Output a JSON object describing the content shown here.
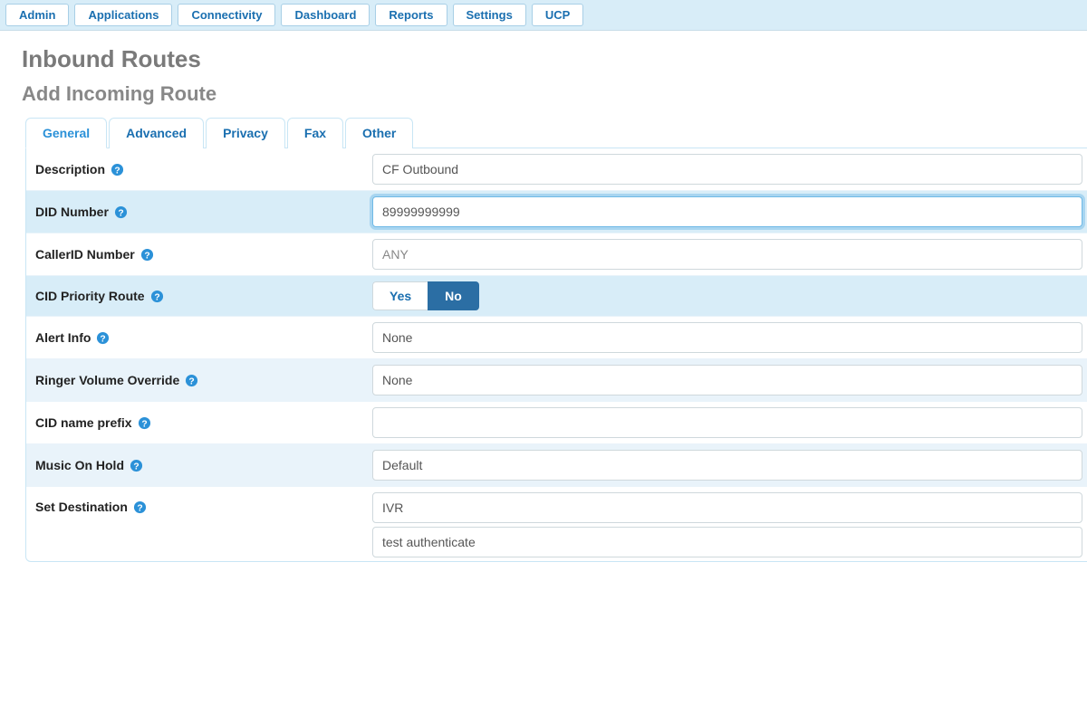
{
  "topnav": {
    "items": [
      "Admin",
      "Applications",
      "Connectivity",
      "Dashboard",
      "Reports",
      "Settings",
      "UCP"
    ]
  },
  "page_title": "Inbound Routes",
  "page_subtitle": "Add Incoming Route",
  "tabs": {
    "items": [
      "General",
      "Advanced",
      "Privacy",
      "Fax",
      "Other"
    ],
    "active": "General"
  },
  "form": {
    "description": {
      "label": "Description",
      "value": "CF Outbound"
    },
    "did_number": {
      "label": "DID Number",
      "value": "89999999999"
    },
    "callerid_number": {
      "label": "CallerID Number",
      "placeholder": "ANY",
      "value": ""
    },
    "cid_priority_route": {
      "label": "CID Priority Route",
      "yes": "Yes",
      "no": "No",
      "value": "No"
    },
    "alert_info": {
      "label": "Alert Info",
      "value": "None"
    },
    "ringer_volume_override": {
      "label": "Ringer Volume Override",
      "value": "None"
    },
    "cid_name_prefix": {
      "label": "CID name prefix",
      "value": ""
    },
    "music_on_hold": {
      "label": "Music On Hold",
      "value": "Default"
    },
    "set_destination": {
      "label": "Set Destination",
      "value": "IVR",
      "sub_value": "test authenticate"
    }
  }
}
